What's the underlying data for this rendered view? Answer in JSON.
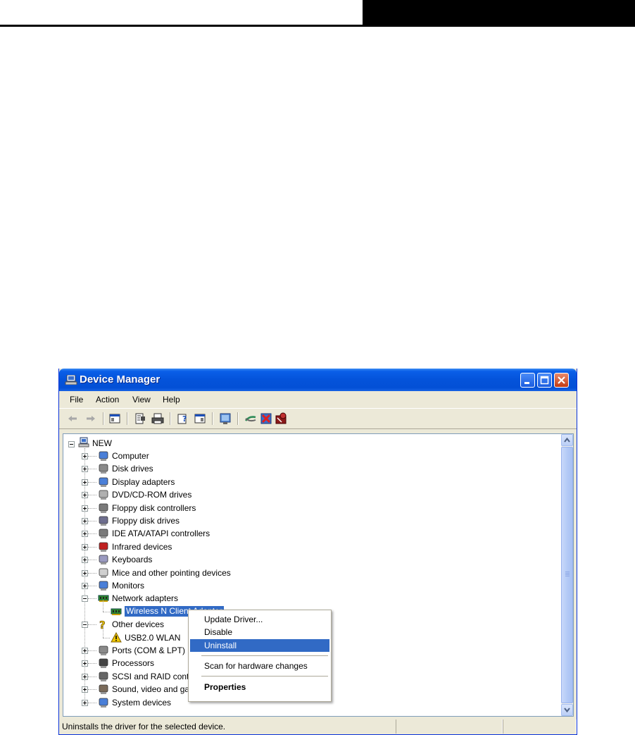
{
  "window": {
    "title": "Device Manager",
    "title_color": "#0453DA"
  },
  "menu": [
    "File",
    "Action",
    "View",
    "Help"
  ],
  "tree": {
    "root": "NEW",
    "items": [
      {
        "label": "Computer",
        "icon": "computer-icon"
      },
      {
        "label": "Disk drives",
        "icon": "disk-drive-icon"
      },
      {
        "label": "Display adapters",
        "icon": "display-adapter-icon"
      },
      {
        "label": "DVD/CD-ROM drives",
        "icon": "dvd-drive-icon"
      },
      {
        "label": "Floppy disk controllers",
        "icon": "controller-icon"
      },
      {
        "label": "Floppy disk drives",
        "icon": "floppy-drive-icon"
      },
      {
        "label": "IDE ATA/ATAPI controllers",
        "icon": "ide-controller-icon"
      },
      {
        "label": "Infrared devices",
        "icon": "infrared-icon"
      },
      {
        "label": "Keyboards",
        "icon": "keyboard-icon"
      },
      {
        "label": "Mice and other pointing devices",
        "icon": "mouse-icon"
      },
      {
        "label": "Monitors",
        "icon": "monitor-icon"
      },
      {
        "label": "Network adapters",
        "icon": "network-adapter-icon",
        "expanded": true
      },
      {
        "label": "Wireless N Client Adapter",
        "icon": "network-card-icon",
        "child": true,
        "selected": true
      },
      {
        "label": "Other devices",
        "icon": "unknown-device-icon",
        "expanded": true
      },
      {
        "label": "USB2.0 WLAN",
        "icon": "warning-device-icon",
        "child": true
      },
      {
        "label": "Ports (COM & LPT)",
        "icon": "port-icon"
      },
      {
        "label": "Processors",
        "icon": "processor-icon"
      },
      {
        "label": "SCSI and RAID controllers",
        "icon": "scsi-icon"
      },
      {
        "label": "Sound, video and game controllers",
        "icon": "sound-icon"
      },
      {
        "label": "System devices",
        "icon": "system-device-icon"
      }
    ]
  },
  "context_menu": {
    "items": [
      "Update Driver...",
      "Disable",
      "Uninstall",
      "Scan for hardware changes",
      "Properties"
    ],
    "highlighted": "Uninstall"
  },
  "status": {
    "text": "Uninstalls the driver for the selected device."
  },
  "colors": {
    "selection": "#316AC5",
    "window_face": "#ECE9D8"
  }
}
